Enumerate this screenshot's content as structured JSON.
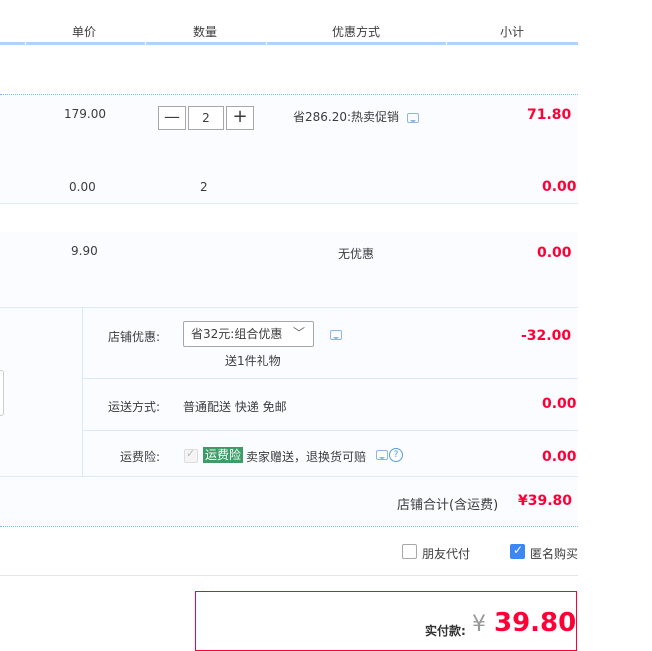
{
  "header": {
    "col_price": "单价",
    "col_qty": "数量",
    "col_promo": "优惠方式",
    "col_subtotal": "小计"
  },
  "items": [
    {
      "unit_price": "179.00",
      "qty": "2",
      "promo": "省286.20:热卖促销",
      "subtotal": "71.80",
      "minus": "—",
      "plus": "+"
    },
    {
      "unit_price": "0.00",
      "qty": "2",
      "subtotal": "0.00"
    },
    {
      "unit_price": "9.90",
      "promo": "无优惠",
      "subtotal": "0.00"
    }
  ],
  "shop": {
    "discount_label": "店铺优惠:",
    "discount_select": "省32元:组合优惠",
    "gift_note": "送1件礼物",
    "discount_value": "-32.00",
    "shipping_label": "运送方式:",
    "shipping_value": "普通配送 快递 免邮",
    "shipping_cost": "0.00",
    "insurance_label": "运费险:",
    "insurance_badge": "运费险",
    "insurance_text": "卖家赠送，退换货可赔",
    "insurance_cost": "0.00",
    "total_label": "店铺合计(含运费)",
    "total_value": "¥39.80"
  },
  "options": {
    "friend_pay": "朋友代付",
    "anonymous": "匿名购买"
  },
  "payment": {
    "label": "实付款:",
    "currency": "¥",
    "amount": "39.80"
  },
  "colors": {
    "accent": "#ff0036",
    "band": "#fbfcff",
    "header_line": "#b2d1ff"
  }
}
